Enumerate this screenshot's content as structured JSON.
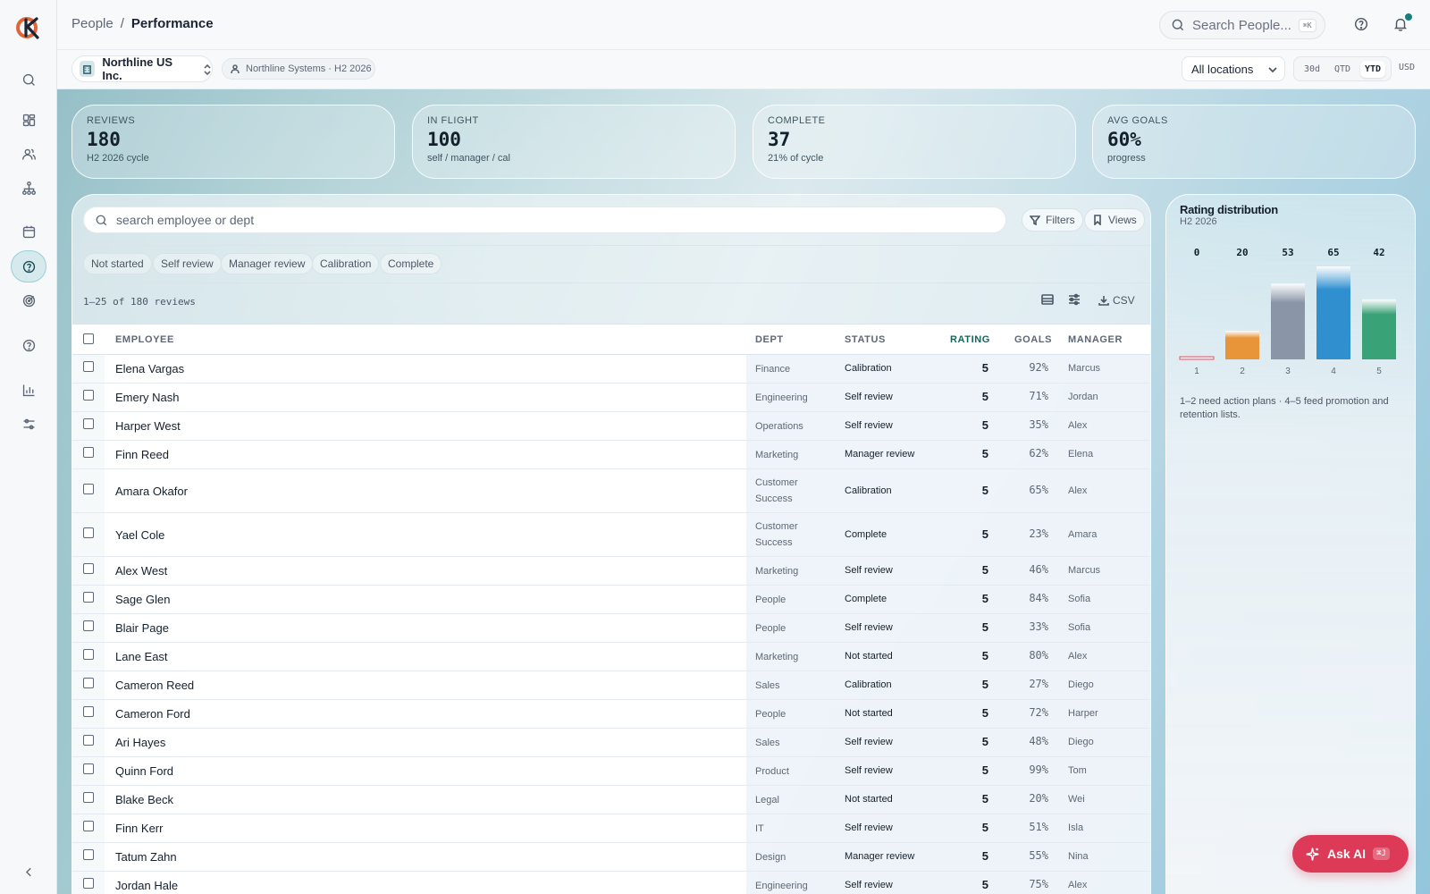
{
  "app": {
    "brand_initials": "K"
  },
  "colors": {
    "accent": "#17807f",
    "ask_ai": "#dd3a57",
    "bar1": "#e0566a",
    "bar2": "#e8953a",
    "bar3": "#8a95a8",
    "bar4": "#2f8fcf",
    "bar5": "#3aa277"
  },
  "sidebar": {
    "items": [
      {
        "icon": "search-icon"
      },
      {
        "icon": "dashboard-icon"
      },
      {
        "icon": "people-icon"
      },
      {
        "icon": "org-chart-icon"
      },
      {
        "icon": "calendar-icon"
      },
      {
        "icon": "performance-icon",
        "active": true
      },
      {
        "icon": "target-icon"
      },
      {
        "icon": "help-icon"
      },
      {
        "icon": "analytics-icon"
      },
      {
        "icon": "settings-icon"
      }
    ],
    "collapse_icon": "chevron-left-icon"
  },
  "header": {
    "breadcrumb_parent": "People",
    "breadcrumb_sep": "/",
    "breadcrumb_current": "Performance",
    "search_placeholder": "Search People...",
    "search_shortcut": "⌘K"
  },
  "subbar": {
    "company": "Northline US Inc.",
    "org_chip": "Northline Systems · H2 2026",
    "location": "All locations",
    "ranges": [
      "30d",
      "QTD",
      "YTD"
    ],
    "active_range": "YTD",
    "currency": "USD"
  },
  "kpis": [
    {
      "label": "Reviews",
      "value": "180",
      "sub": "H2 2026 cycle"
    },
    {
      "label": "In flight",
      "value": "100",
      "sub": "self / manager / cal"
    },
    {
      "label": "Complete",
      "value": "37",
      "sub": "21% of cycle"
    },
    {
      "label": "Avg goals",
      "value": "60%",
      "sub": "progress"
    }
  ],
  "table": {
    "search_placeholder": "search employee or dept",
    "filters_label": "Filters",
    "views_label": "Views",
    "status_chips": [
      "Not started",
      "Self review",
      "Manager review",
      "Calibration",
      "Complete"
    ],
    "result_count": "1–25 of 180 reviews",
    "csv_label": "CSV",
    "columns": {
      "employee": "EMPLOYEE",
      "dept": "DEPT",
      "status": "STATUS",
      "rating": "RATING",
      "goals": "GOALS",
      "manager": "MANAGER"
    },
    "rows": [
      {
        "name": "Elena Vargas",
        "dept": "Finance",
        "status": "Calibration",
        "rating": "5",
        "goals": "92%",
        "manager": "Marcus"
      },
      {
        "name": "Emery Nash",
        "dept": "Engineering",
        "status": "Self review",
        "rating": "5",
        "goals": "71%",
        "manager": "Jordan"
      },
      {
        "name": "Harper West",
        "dept": "Operations",
        "status": "Self review",
        "rating": "5",
        "goals": "35%",
        "manager": "Alex"
      },
      {
        "name": "Finn Reed",
        "dept": "Marketing",
        "status": "Manager review",
        "rating": "5",
        "goals": "62%",
        "manager": "Elena"
      },
      {
        "name": "Amara Okafor",
        "dept": "Customer Success",
        "status": "Calibration",
        "rating": "5",
        "goals": "65%",
        "manager": "Alex"
      },
      {
        "name": "Yael Cole",
        "dept": "Customer Success",
        "status": "Complete",
        "rating": "5",
        "goals": "23%",
        "manager": "Amara"
      },
      {
        "name": "Alex West",
        "dept": "Marketing",
        "status": "Self review",
        "rating": "5",
        "goals": "46%",
        "manager": "Marcus"
      },
      {
        "name": "Sage Glen",
        "dept": "People",
        "status": "Complete",
        "rating": "5",
        "goals": "84%",
        "manager": "Sofia"
      },
      {
        "name": "Blair Page",
        "dept": "People",
        "status": "Self review",
        "rating": "5",
        "goals": "33%",
        "manager": "Sofia"
      },
      {
        "name": "Lane East",
        "dept": "Marketing",
        "status": "Not started",
        "rating": "5",
        "goals": "80%",
        "manager": "Alex"
      },
      {
        "name": "Cameron Reed",
        "dept": "Sales",
        "status": "Calibration",
        "rating": "5",
        "goals": "27%",
        "manager": "Diego"
      },
      {
        "name": "Cameron Ford",
        "dept": "People",
        "status": "Not started",
        "rating": "5",
        "goals": "72%",
        "manager": "Harper"
      },
      {
        "name": "Ari Hayes",
        "dept": "Sales",
        "status": "Self review",
        "rating": "5",
        "goals": "48%",
        "manager": "Diego"
      },
      {
        "name": "Quinn Ford",
        "dept": "Product",
        "status": "Self review",
        "rating": "5",
        "goals": "99%",
        "manager": "Tom"
      },
      {
        "name": "Blake Beck",
        "dept": "Legal",
        "status": "Not started",
        "rating": "5",
        "goals": "20%",
        "manager": "Wei"
      },
      {
        "name": "Finn Kerr",
        "dept": "IT",
        "status": "Self review",
        "rating": "5",
        "goals": "51%",
        "manager": "Isla"
      },
      {
        "name": "Tatum Zahn",
        "dept": "Design",
        "status": "Manager review",
        "rating": "5",
        "goals": "55%",
        "manager": "Nina"
      },
      {
        "name": "Jordan Hale",
        "dept": "Engineering",
        "status": "Self review",
        "rating": "5",
        "goals": "75%",
        "manager": "Alex"
      }
    ]
  },
  "distribution": {
    "title": "Rating distribution",
    "subtitle": "H2 2026",
    "note": "1–2 need action plans · 4–5 feed promotion and retention lists."
  },
  "chart_data": {
    "type": "bar",
    "title": "Rating distribution",
    "subtitle": "H2 2026",
    "categories": [
      "1",
      "2",
      "3",
      "4",
      "5"
    ],
    "values": [
      0,
      20,
      53,
      65,
      42
    ],
    "ylim": [
      0,
      65
    ],
    "grid": false
  },
  "ask_ai": {
    "label": "Ask AI",
    "shortcut": "⌘J"
  }
}
